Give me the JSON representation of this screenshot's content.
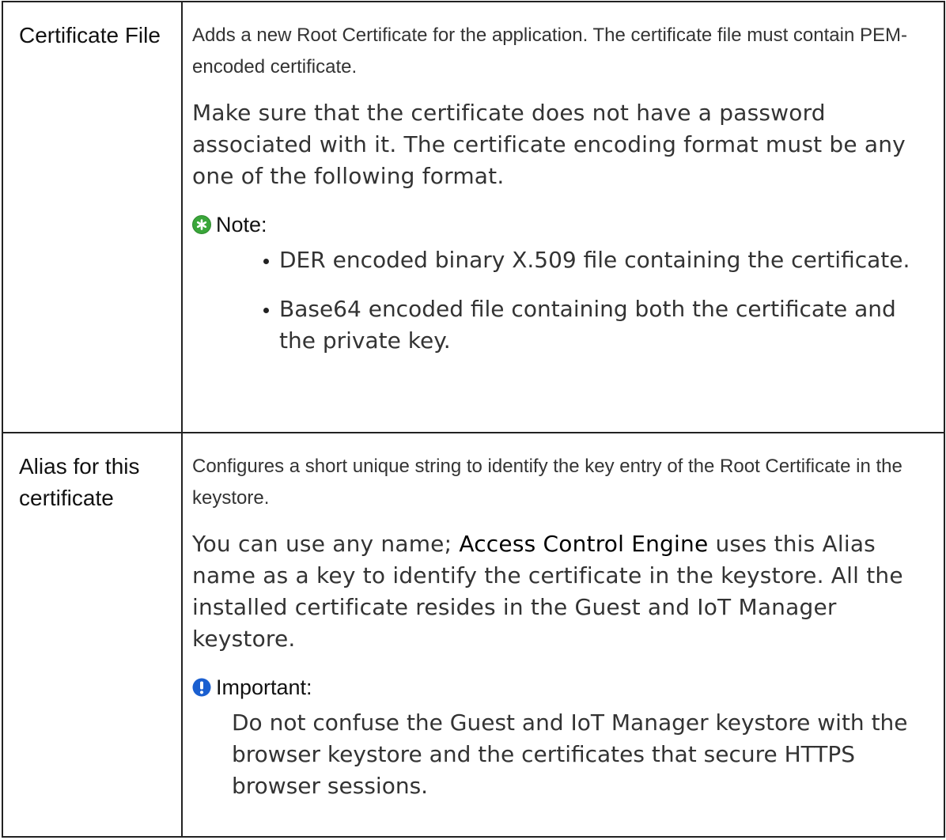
{
  "rows": [
    {
      "name": "Certificate File",
      "intro": "Adds a new Root Certificate for the application. The certificate file must contain PEM-encoded certificate.",
      "detail": "Make sure that the certificate does not have a password associated with it. The certificate encoding format must be any one of the following format.",
      "callout": {
        "type": "note",
        "title": "Note:",
        "icon": "green-star-icon",
        "icon_color": "#3aa63a",
        "items": [
          "DER encoded binary X.509 file containing the certificate.",
          "Base64 encoded file containing both the certificate and the private key."
        ]
      }
    },
    {
      "name": "Alias for this certificate",
      "intro": "Configures a short unique string to identify the key entry of the Root Certificate in the keystore.",
      "detail_before": "You can use any name; ",
      "detail_emphasis": "Access Control Engine",
      "detail_after": " uses this Alias name as a key to identify the certificate in the keystore. All the installed certificate resides in the Guest and IoT Manager keystore.",
      "callout": {
        "type": "important",
        "title": "Important:",
        "icon": "blue-exclamation-icon",
        "icon_color": "#1a5fd0",
        "body": "Do not confuse the Guest and IoT Manager keystore with the browser keystore and the certificates that secure HTTPS browser sessions."
      }
    }
  ]
}
